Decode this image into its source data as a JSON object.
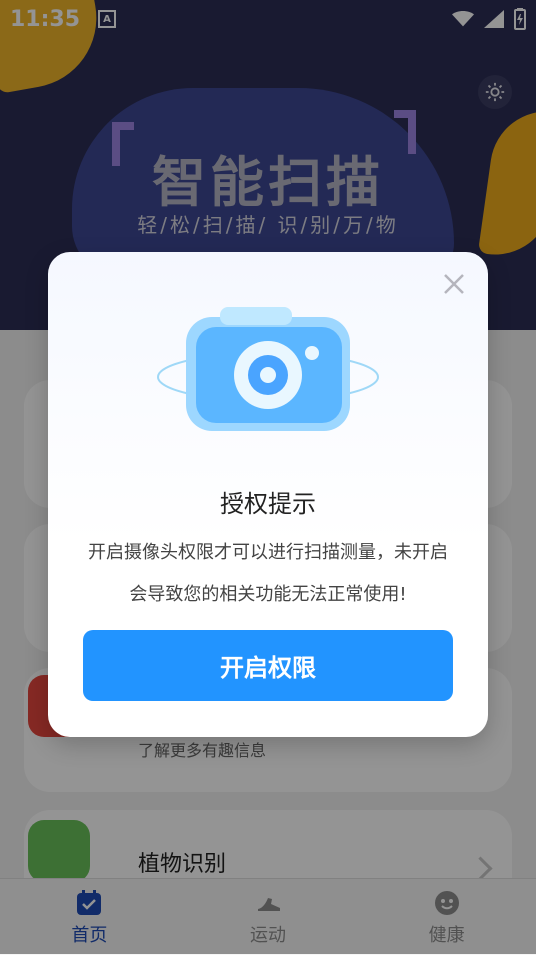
{
  "status_bar": {
    "time": "11:35",
    "input_badge": "A"
  },
  "hero": {
    "title": "智能扫描",
    "subtitle": "轻/松/扫/描/ 识/别/万/物"
  },
  "background_list": [
    {
      "subtitle": "了解更多有趣信息"
    },
    {
      "title": "植物识别"
    }
  ],
  "tabbar": {
    "tabs": [
      {
        "label": "首页"
      },
      {
        "label": "运动"
      },
      {
        "label": "健康"
      }
    ]
  },
  "dialog": {
    "title": "授权提示",
    "message_line1": "开启摄像头权限才可以进行扫描测量，未开启",
    "message_line2": "会导致您的相关功能无法正常使用!",
    "button_label": "开启权限"
  },
  "colors": {
    "accent": "#2294ff",
    "hero_bg": "#2b2d55",
    "tab_active": "#1e4bb5"
  },
  "icons": {
    "settings": "gear-icon",
    "close": "close-icon",
    "camera": "camera-icon",
    "home": "calendar-check-icon",
    "sports": "shoe-icon",
    "health": "smile-icon"
  }
}
